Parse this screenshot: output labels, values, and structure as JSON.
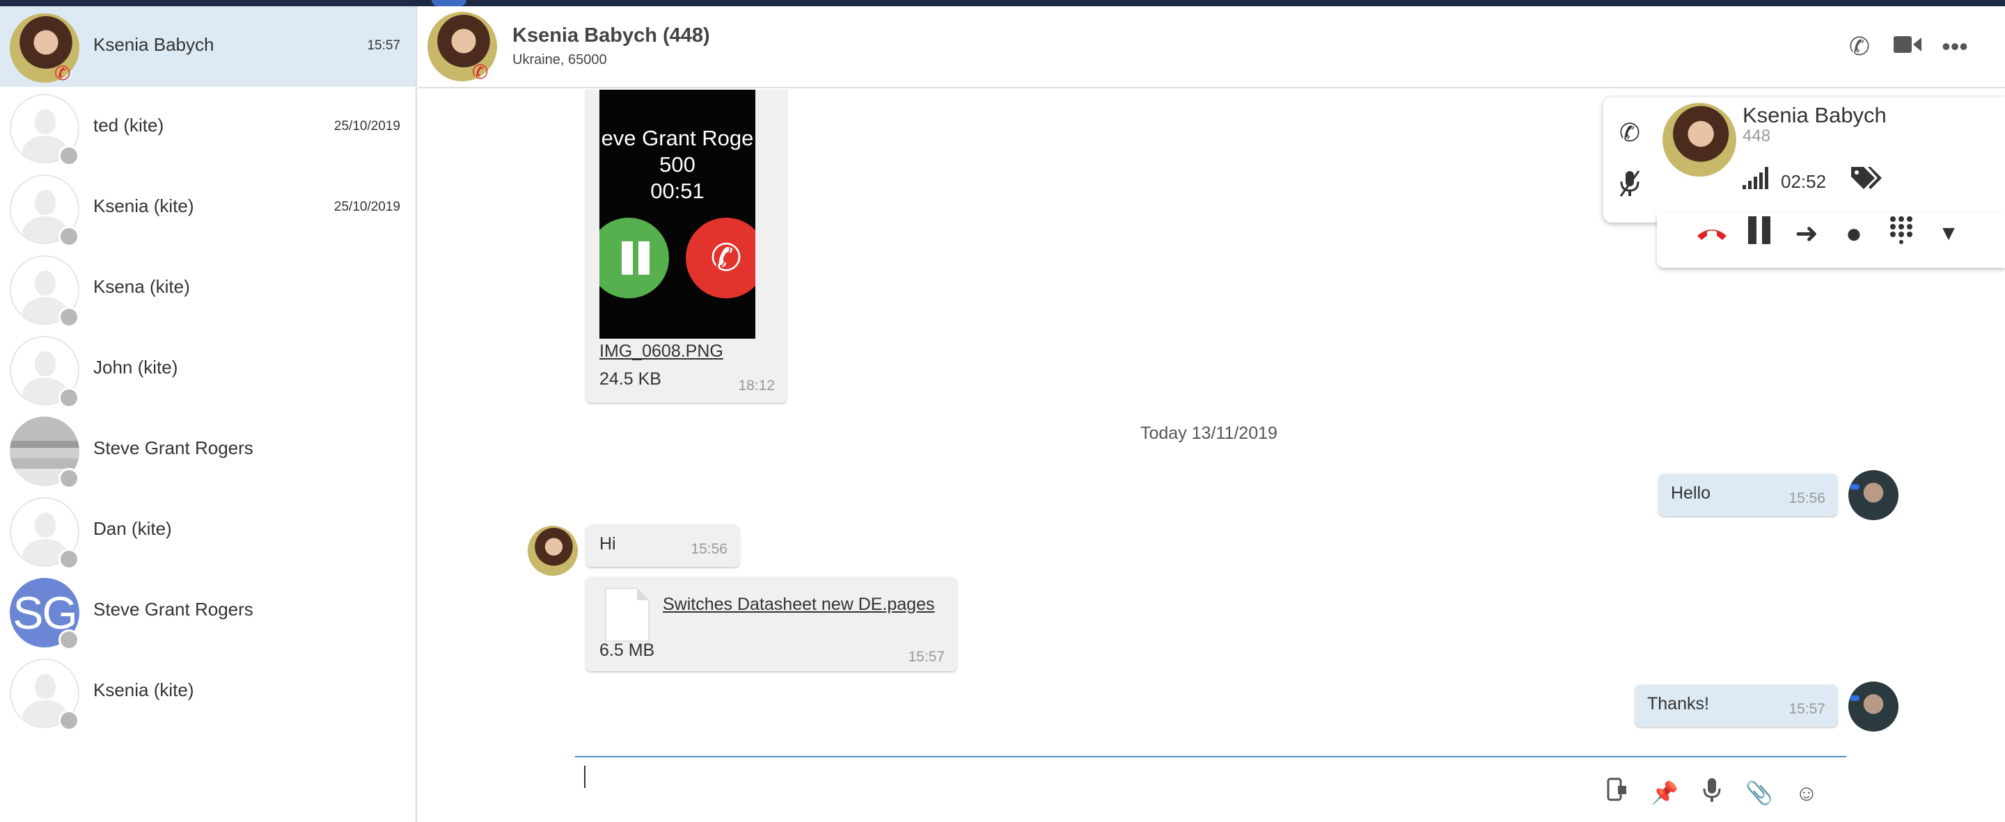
{
  "contacts": [
    {
      "name": "Ksenia Babych",
      "time": "15:57",
      "avatar": "photo",
      "active": true
    },
    {
      "name": "ted (kite)",
      "time": "25/10/2019",
      "avatar": "placeholder"
    },
    {
      "name": "Ksenia (kite)",
      "time": "25/10/2019",
      "avatar": "placeholder"
    },
    {
      "name": "Ksena (kite)",
      "time": "",
      "avatar": "placeholder"
    },
    {
      "name": "John (kite)",
      "time": "",
      "avatar": "placeholder"
    },
    {
      "name": "Steve Grant Rogers",
      "time": "",
      "avatar": "screenshot"
    },
    {
      "name": "Dan (kite)",
      "time": "",
      "avatar": "placeholder"
    },
    {
      "name": "Steve Grant Rogers",
      "time": "",
      "avatar": "initials",
      "initials": "SG"
    },
    {
      "name": "Ksenia (kite)",
      "time": "",
      "avatar": "placeholder"
    }
  ],
  "header": {
    "title": "Ksenia Babych (448)",
    "subtitle": "Ukraine, 65000",
    "icons": [
      "phone-icon",
      "video-camera-icon",
      "more-icon"
    ]
  },
  "messages": {
    "image_attachment": {
      "preview_lines": [
        "eve Grant Roge",
        "500",
        "00:51"
      ],
      "filename": "IMG_0608.PNG",
      "size": "24.5 KB",
      "time": "18:12"
    },
    "date_separator": "Today 13/11/2019",
    "hello": {
      "text": "Hello",
      "time": "15:56",
      "direction": "out"
    },
    "hi": {
      "text": "Hi",
      "time": "15:56",
      "direction": "in"
    },
    "file": {
      "filename": "Switches Datasheet new DE.pages",
      "size": "6.5 MB",
      "time": "15:57",
      "direction": "in"
    },
    "thanks": {
      "text": "Thanks!",
      "time": "15:57",
      "direction": "out"
    }
  },
  "composer": {
    "value": "",
    "tools": [
      "call-history-icon",
      "pin-icon",
      "microphone-icon",
      "attachment-icon",
      "emoji-icon"
    ]
  },
  "call": {
    "name": "Ksenia Babych",
    "number": "448",
    "timer": "02:52",
    "signal_bars": 5,
    "controls": [
      "hangup-icon",
      "pause-icon",
      "transfer-icon",
      "record-icon",
      "dialpad-icon",
      "dropdown-icon"
    ],
    "side_icons": [
      "phone-icon",
      "mute-microphone-icon"
    ],
    "hangup_color": "#e02424"
  },
  "colors": {
    "active_contact_bg": "#deeaf3",
    "outgoing_bubble": "#deeaf3",
    "incoming_bubble": "#f0f0f0",
    "composer_line": "#4a90c8"
  }
}
